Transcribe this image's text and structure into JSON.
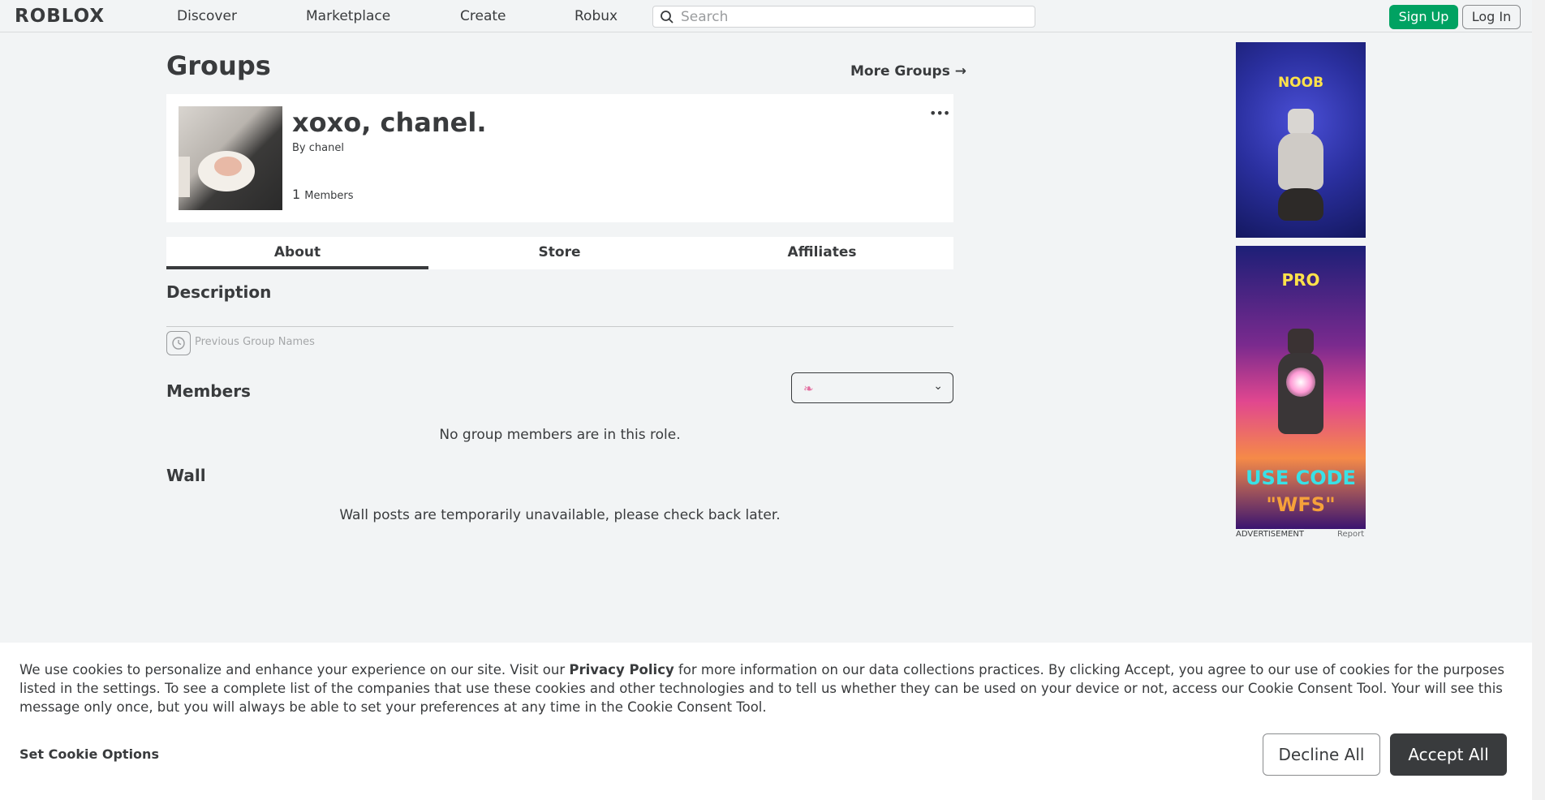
{
  "header": {
    "logo": "ROBLOX",
    "nav": [
      "Discover",
      "Marketplace",
      "Create",
      "Robux"
    ],
    "search_placeholder": "Search",
    "signup": "Sign Up",
    "login": "Log In"
  },
  "page": {
    "title": "Groups",
    "more_groups": "More Groups →"
  },
  "group": {
    "name": "xoxo, chanel.",
    "by_prefix": "By",
    "owner": "chanel",
    "member_count": "1",
    "member_label": "Members",
    "menu": "•••"
  },
  "tabs": [
    "About",
    "Store",
    "Affiliates"
  ],
  "about": {
    "description_title": "Description",
    "previous_names": "Previous Group Names",
    "members_title": "Members",
    "members_empty": "No group members are in this role.",
    "wall_title": "Wall",
    "wall_msg": "Wall posts are temporarily unavailable, please check back later."
  },
  "ads": {
    "ad1_text": "NOOB",
    "ad2_top": "PRO",
    "ad2_bottom_1": "USE CODE",
    "ad2_bottom_2": "\"WFS\"",
    "label": "ADVERTISEMENT",
    "report": "Report"
  },
  "cookie": {
    "text_before": "We use cookies to personalize and enhance your experience on our site. Visit our ",
    "policy": "Privacy Policy",
    "text_after": " for more information on our data collections practices. By clicking Accept, you agree to our use of cookies for the purposes listed in the settings. To see a complete list of the companies that use these cookies and other technologies and to tell us whether they can be used on your device or not, access our Cookie Consent Tool. Your will see this message only once, but you will always be able to set your preferences at any time in the Cookie Consent Tool.",
    "set_options": "Set Cookie Options",
    "decline": "Decline All",
    "accept": "Accept All"
  },
  "colors": {
    "signup_green": "#00a262",
    "dark": "#393b3d",
    "background": "#f2f4f5"
  }
}
